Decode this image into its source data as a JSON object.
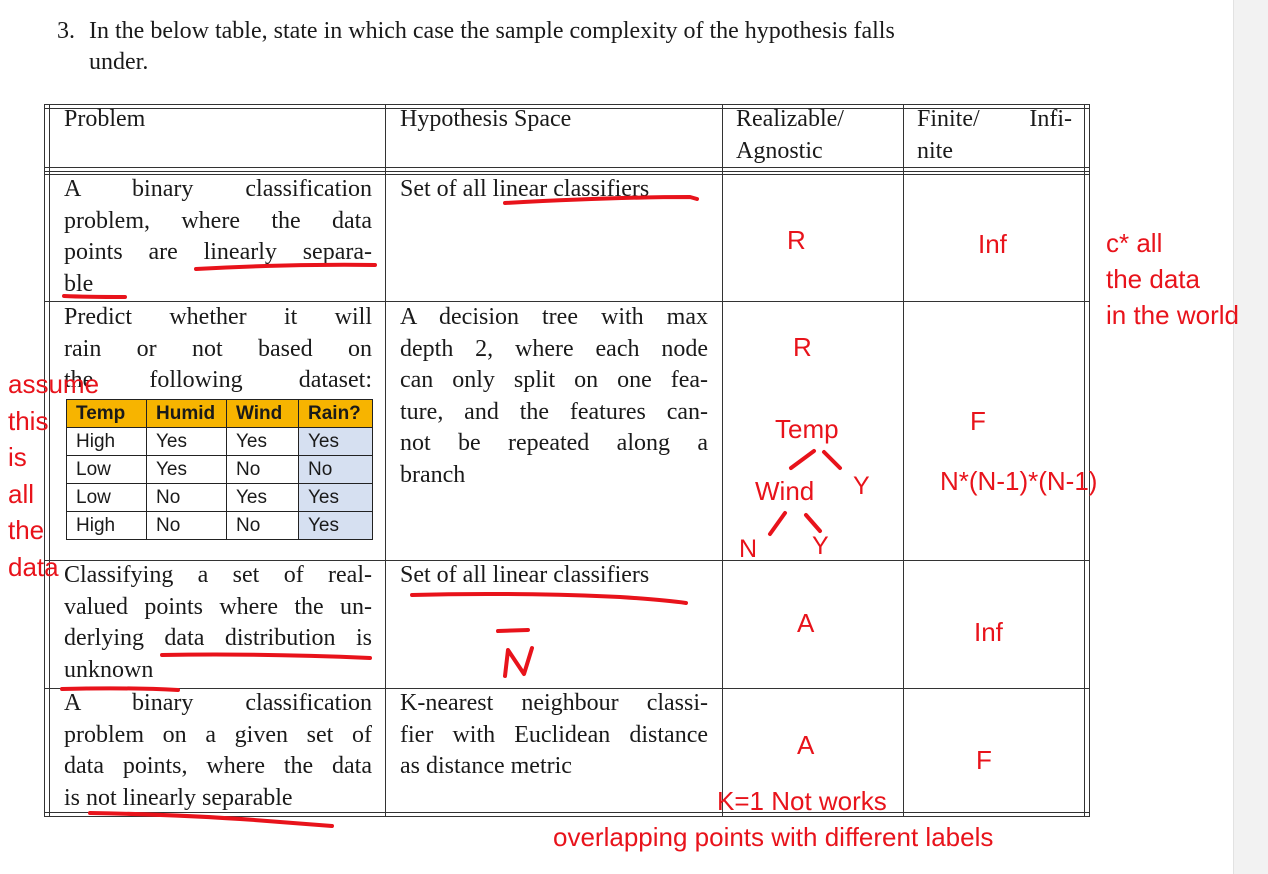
{
  "question": {
    "number": "3.",
    "text_line1": "In the below table, state in which case the sample complexity of the hypothesis falls",
    "text_line2": "under."
  },
  "table": {
    "headers": {
      "problem": "Problem",
      "hypothesis": "Hypothesis Space",
      "realizable_1": "Realizable/",
      "realizable_2": "Agnostic",
      "finite_1a": "Finite/",
      "finite_1b": "Infi-",
      "finite_2": "nite"
    },
    "rows": [
      {
        "problem_lines": [
          "A binary classification",
          "problem, where the data",
          "points are linearly separa-",
          "ble"
        ],
        "hypothesis_lines": [
          "Set of all linear classifiers"
        ],
        "answer_ra": "R",
        "answer_fi": "Inf"
      },
      {
        "problem_lines": [
          "Predict whether it will",
          "rain or not based on",
          "the following dataset:"
        ],
        "hypothesis_lines": [
          "A decision tree with max",
          "depth 2, where each node",
          "can only split on one fea-",
          "ture, and the features can-",
          "not be repeated along a",
          "branch"
        ],
        "answer_ra": "R",
        "answer_fi": "F"
      },
      {
        "problem_lines": [
          "Classifying a set of real-",
          "valued points where the un-",
          "derlying data distribution is",
          "unknown"
        ],
        "hypothesis_lines": [
          "Set of all linear classifiers"
        ],
        "answer_ra": "A",
        "answer_fi": "Inf"
      },
      {
        "problem_lines": [
          "A binary classification",
          "problem on a given set of",
          "data points, where the data",
          "is not linearly separable"
        ],
        "hypothesis_lines": [
          "K-nearest neighbour classi-",
          "fier with Euclidean distance",
          "as distance metric"
        ],
        "answer_ra": "A",
        "answer_fi": "F"
      }
    ]
  },
  "dataset": {
    "headers": [
      "Temp",
      "Humid",
      "Wind",
      "Rain?"
    ],
    "rows": [
      [
        "High",
        "Yes",
        "Yes",
        "Yes"
      ],
      [
        "Low",
        "Yes",
        "No",
        "No"
      ],
      [
        "Low",
        "No",
        "Yes",
        "Yes"
      ],
      [
        "High",
        "No",
        "No",
        "Yes"
      ]
    ],
    "header_color": "#f7b400",
    "label_column_color": "#d6e0f1"
  },
  "annotations": {
    "side_note": [
      "c* all",
      "the data",
      "in the world"
    ],
    "left_note": [
      "assume",
      "this",
      "is",
      "all",
      "the",
      "data"
    ],
    "tree_root": "Temp",
    "tree_child": "Wind",
    "tree_leaf_y": "Y",
    "tree_leaf_n": "N",
    "tree_leaf_y2": "Y",
    "tree_count": "N*(N-1)*(N-1)",
    "knn_note": "K=1 Not works",
    "overlap_note": "overlapping points with different labels",
    "ink_color": "#e8131b"
  }
}
